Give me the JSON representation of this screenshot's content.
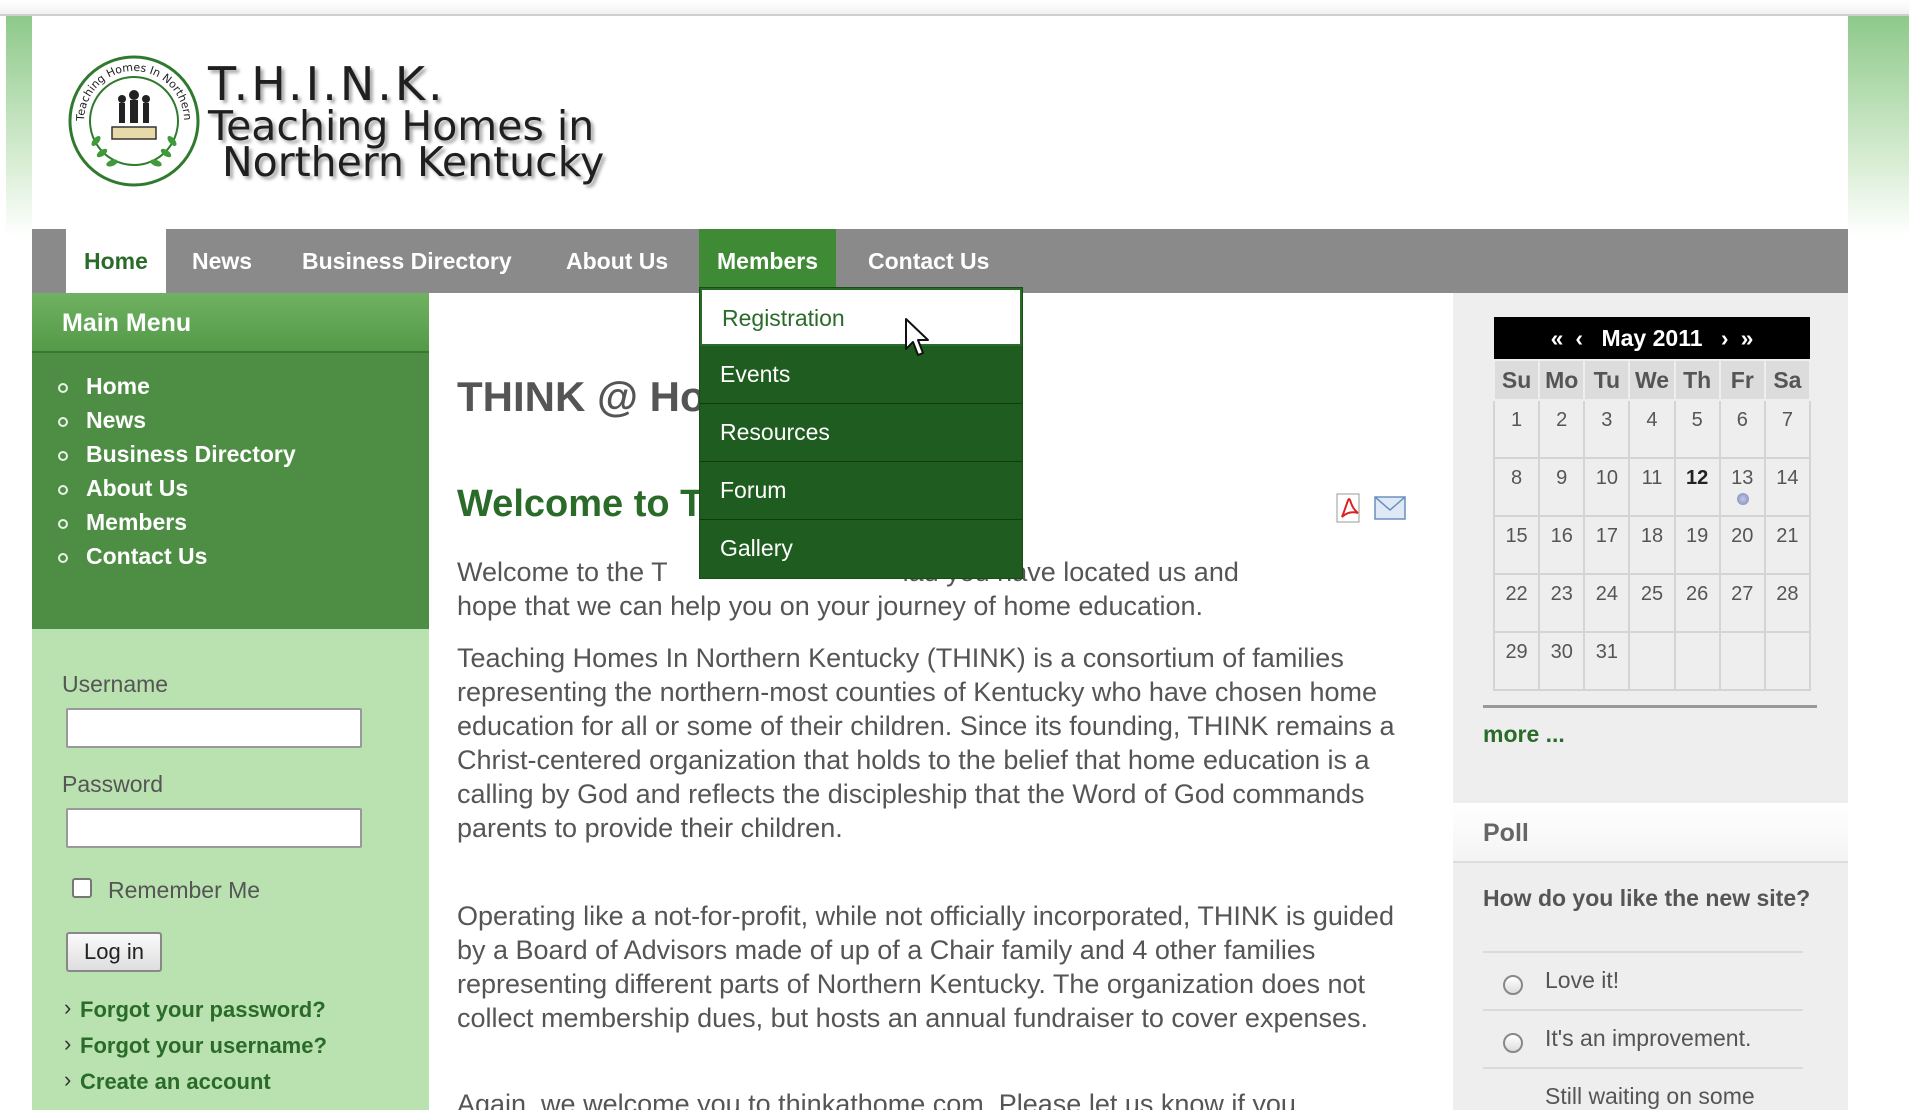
{
  "header": {
    "logo_line1": "T.H.I.N.K.",
    "logo_line2": "Teaching Homes in",
    "logo_line3": "Northern Kentucky",
    "seal_text": "Teaching Homes In Northern Kentucky"
  },
  "nav": {
    "items": [
      "Home",
      "News",
      "Business Directory",
      "About Us",
      "Members",
      "Contact Us"
    ],
    "active": "Home",
    "open": "Members"
  },
  "dropdown": {
    "items": [
      "Registration",
      "Events",
      "Resources",
      "Forum",
      "Gallery"
    ],
    "hovered": "Registration"
  },
  "main_menu": {
    "title": "Main Menu",
    "items": [
      "Home",
      "News",
      "Business Directory",
      "About Us",
      "Members",
      "Contact Us"
    ]
  },
  "login": {
    "username_label": "Username",
    "username_value": "",
    "password_label": "Password",
    "password_value": "",
    "remember_label": "Remember Me",
    "button_label": "Log in",
    "links": [
      "Forgot your password?",
      "Forgot your username?",
      "Create an account"
    ]
  },
  "content": {
    "page_title": "THINK @ Ho",
    "article_title": "Welcome to T",
    "para1_start": "Welcome to the T",
    "para1_end": "lad you have located us and",
    "para1_line2": "hope that we can help you on your journey of home education.",
    "para2": "Teaching Homes In Northern Kentucky (THINK) is a consortium of families representing the northern-most counties of Kentucky who have chosen home education for all or some of their children.  Since its founding, THINK remains a Christ-centered organization that holds to the belief that home education is a calling by God and reflects the discipleship that the Word of God commands parents to provide their children.",
    "para3": "Operating like a not-for-profit, while not officially incorporated, THINK is guided by a Board of Advisors made of up of a Chair family and 4 other families representing different parts of Northern Kentucky.  The organization does not collect membership dues, but hosts an annual fundraiser to cover expenses.",
    "para4": "Again, we welcome you to thinkathome.com. Please let us know if you"
  },
  "calendar": {
    "prev_year": "«",
    "prev_month": "‹",
    "month_label": "May 2011",
    "next_month": "›",
    "next_year": "»",
    "weekdays": [
      "Su",
      "Mo",
      "Tu",
      "We",
      "Th",
      "Fr",
      "Sa"
    ],
    "weeks": [
      [
        "1",
        "2",
        "3",
        "4",
        "5",
        "6",
        "7"
      ],
      [
        "8",
        "9",
        "10",
        "11",
        "12",
        "13",
        "14"
      ],
      [
        "15",
        "16",
        "17",
        "18",
        "19",
        "20",
        "21"
      ],
      [
        "22",
        "23",
        "24",
        "25",
        "26",
        "27",
        "28"
      ],
      [
        "29",
        "30",
        "31",
        "",
        "",
        "",
        ""
      ]
    ],
    "today": "12",
    "event_day": "13",
    "more_label": "more ..."
  },
  "poll": {
    "title": "Poll",
    "question": "How do you like the new site?",
    "options": [
      "Love it!",
      "It's an improvement.",
      "Still waiting on some"
    ]
  },
  "colors": {
    "brand_green": "#2b6b2a",
    "menu_green": "#4e8e44",
    "login_green": "#b9e2b0",
    "dropdown_green": "#1f5c1f",
    "nav_gray": "#8a8a8a"
  }
}
